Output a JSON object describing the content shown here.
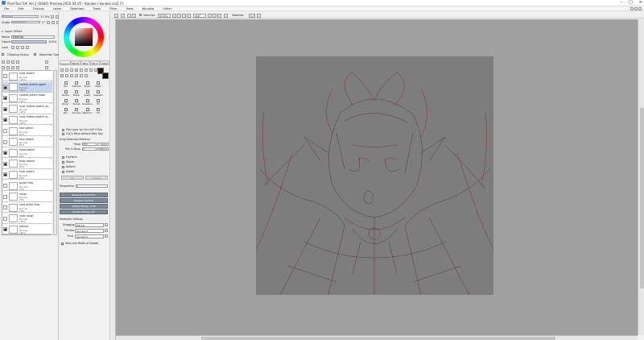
{
  "window": {
    "title": "PaintTool SAI Ver.2 (64bit) Preview.2023.04.05 - Kanake / kanake.sai2 (*)"
  },
  "menu": [
    "File",
    "Edit",
    "Canvas",
    "Layer",
    "Selection",
    "Tools",
    "Filter",
    "View",
    "Window",
    "Other"
  ],
  "left": {
    "brush_size_label": "Size",
    "brush_size_value": "17.0%",
    "angle_label": "Angle",
    "angle_value": "0°",
    "group_label": "Layer Effect",
    "mode_label": "Mode",
    "mode_value": "Normal",
    "opacity_label": "Opacity",
    "opacity_value": "100%",
    "lock_label": "Lock",
    "clipping_label": "Clipping Group",
    "selection_source_label": "Selection Source"
  },
  "layers": [
    {
      "name": "eyes sketch",
      "mode": "Normal",
      "opacity": "100%",
      "visible": false,
      "selected": false
    },
    {
      "name": "clothes sketch again",
      "mode": "Normal",
      "opacity": "100%",
      "visible": true,
      "selected": true
    },
    {
      "name": "clothes sketch loose",
      "mode": "Normal",
      "opacity": "100%",
      "visible": true,
      "selected": false
    },
    {
      "name": "rude clothes sketch ps...",
      "mode": "Normal",
      "opacity": "100%",
      "visible": true,
      "selected": false
    },
    {
      "name": "rude clothes sketch lo...",
      "mode": "Normal",
      "opacity": "100%",
      "visible": true,
      "selected": false
    },
    {
      "name": "hair sketch",
      "mode": "Normal",
      "opacity": "80%",
      "visible": false,
      "selected": false
    },
    {
      "name": "face sketch",
      "mode": "Normal",
      "opacity": "80%",
      "visible": false,
      "selected": false
    },
    {
      "name": "head sketch",
      "mode": "Normal",
      "opacity": "80%",
      "visible": true,
      "selected": false
    },
    {
      "name": "body sketch",
      "mode": "Normal",
      "opacity": "80%",
      "visible": true,
      "selected": false
    },
    {
      "name": "rude sketch",
      "mode": "Normal",
      "opacity": "80%",
      "visible": true,
      "selected": false
    },
    {
      "name": "guide lines",
      "mode": "Normal",
      "opacity": "50%",
      "visible": false,
      "selected": false
    },
    {
      "name": "rough",
      "mode": "Normal",
      "opacity": "30%",
      "visible": false,
      "selected": false
    },
    {
      "name": "rude guide lines",
      "mode": "Normal",
      "opacity": "50%",
      "visible": false,
      "selected": false
    },
    {
      "name": "rude rough",
      "mode": "Normal",
      "opacity": "100%",
      "visible": false,
      "selected": false
    },
    {
      "name": "ground",
      "mode": "Normal",
      "opacity": "100%",
      "visible": true,
      "selected": false
    }
  ],
  "toolpanel": {
    "tabs": [
      "Support",
      "Mode",
      "Misc",
      "No.1",
      "Artist"
    ],
    "tools": [
      "Pen",
      "AirBrush",
      "Brush",
      "Water",
      "Marker",
      "Eraser",
      "Select",
      "Deselect",
      "Binder",
      "Bucket",
      "Gradation",
      "Fill",
      "Blur",
      "Smudge",
      "Watercol.",
      "Oil"
    ],
    "pick_layer_label": "Pick Layer by Ctrl+ALT+Click",
    "cut_move_label": "Cut & Move without Mod. Key",
    "drag_detection_label": "Drag Detection Distance",
    "move_label": "Move",
    "move_value": "10 px",
    "pick_move_label": "Pick & Move",
    "pick_move_value": "1.00 px",
    "options": [
      "Freeform",
      "Resize",
      "Deform",
      "Rotate"
    ],
    "ok_label": "OK",
    "cancel_label": "Cancel",
    "perspective_label": "Perspective",
    "buttons": [
      "Reverse Horizontal",
      "Reverse Vertical",
      "Rotate 90deg. CCW",
      "Rotate 90deg. CW"
    ],
    "resample_label": "Resample Settings",
    "dragging_label": "Dragging",
    "dragging_value": "Bilinear",
    "preview_label": "Preview",
    "preview_value": "Lanczos 3",
    "final_label": "Final",
    "final_value": "Lanczos 3",
    "keep_line_label": "Keep Line Width of Shapes"
  },
  "canvasbar": {
    "selection_label": "Selection",
    "zoom_value": "57.0%",
    "angle_value": "000°",
    "stabilizer_label": "Stabilizer",
    "stabilizer_value": "S-7"
  },
  "colors": {
    "foreground": "#2a0c0c",
    "background": "#000000",
    "accent_selected": "#c7d7f3"
  }
}
